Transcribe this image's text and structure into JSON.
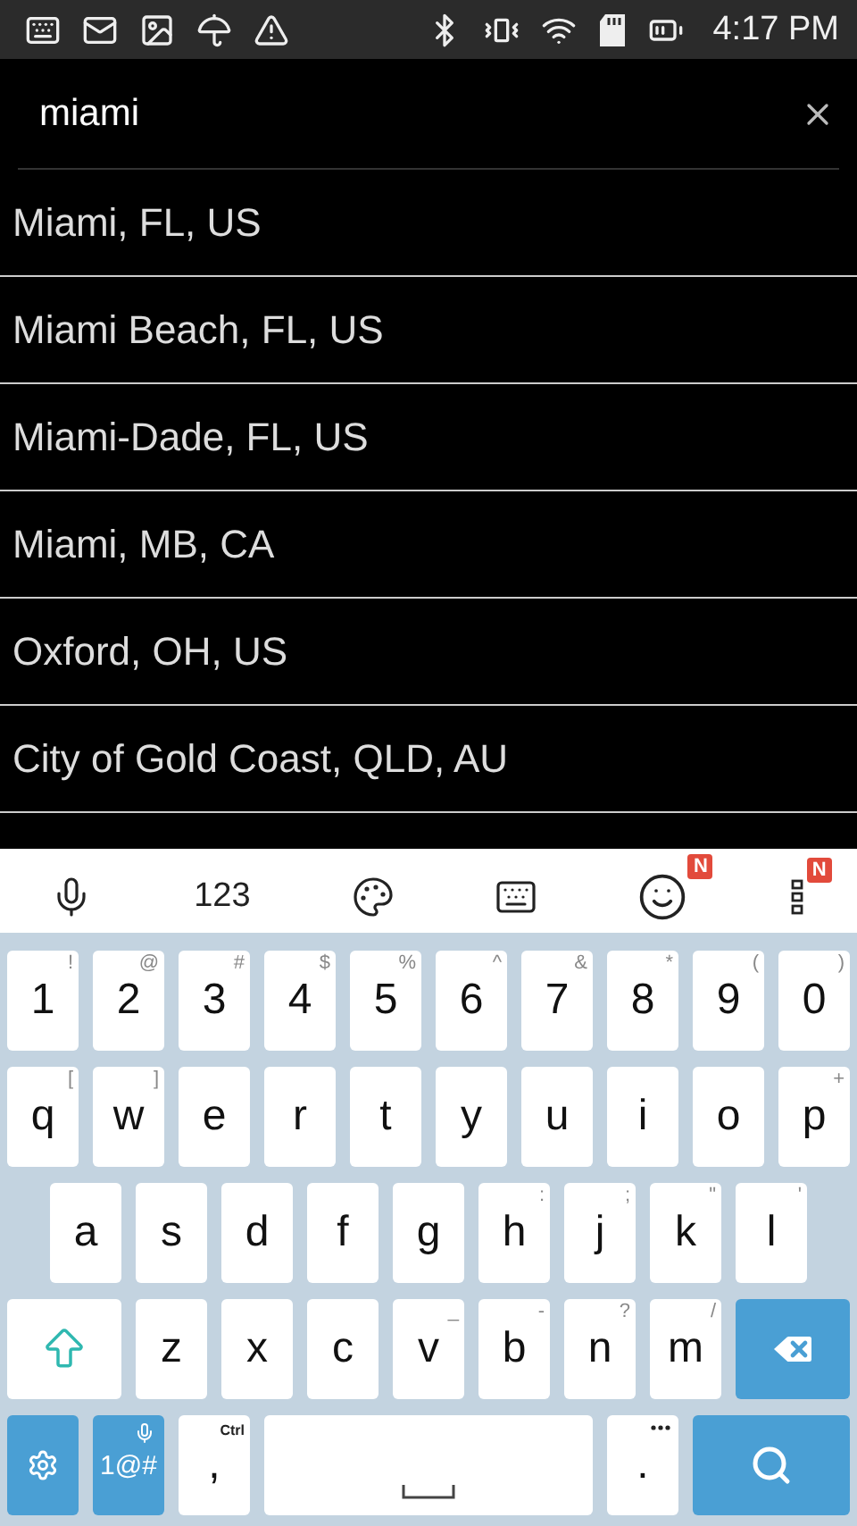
{
  "status_bar": {
    "time": "4:17 PM"
  },
  "search": {
    "value": "miami"
  },
  "results": [
    {
      "label": "Miami, FL, US"
    },
    {
      "label": "Miami Beach, FL, US"
    },
    {
      "label": "Miami-Dade, FL, US"
    },
    {
      "label": "Miami, MB, CA"
    },
    {
      "label": "Oxford, OH, US"
    },
    {
      "label": "City of Gold Coast, QLD, AU"
    }
  ],
  "keyboard_toolbar": [
    {
      "kind": "mic"
    },
    {
      "kind": "text",
      "label": "123"
    },
    {
      "kind": "palette"
    },
    {
      "kind": "hide"
    },
    {
      "kind": "emoji",
      "badge": "N"
    },
    {
      "kind": "menu",
      "badge": "N"
    }
  ],
  "keyboard_rows": [
    [
      {
        "kind": "char",
        "label": "1",
        "hint": "!"
      },
      {
        "kind": "char",
        "label": "2",
        "hint": "@"
      },
      {
        "kind": "char",
        "label": "3",
        "hint": "#"
      },
      {
        "kind": "char",
        "label": "4",
        "hint": "$"
      },
      {
        "kind": "char",
        "label": "5",
        "hint": "%"
      },
      {
        "kind": "char",
        "label": "6",
        "hint": "^"
      },
      {
        "kind": "char",
        "label": "7",
        "hint": "&"
      },
      {
        "kind": "char",
        "label": "8",
        "hint": "*"
      },
      {
        "kind": "char",
        "label": "9",
        "hint": "("
      },
      {
        "kind": "char",
        "label": "0",
        "hint": ")"
      }
    ],
    [
      {
        "kind": "char",
        "label": "q",
        "hint": "["
      },
      {
        "kind": "char",
        "label": "w",
        "hint": "]"
      },
      {
        "kind": "char",
        "label": "e"
      },
      {
        "kind": "char",
        "label": "r"
      },
      {
        "kind": "char",
        "label": "t"
      },
      {
        "kind": "char",
        "label": "y"
      },
      {
        "kind": "char",
        "label": "u"
      },
      {
        "kind": "char",
        "label": "i"
      },
      {
        "kind": "char",
        "label": "o"
      },
      {
        "kind": "char",
        "label": "p",
        "hint": "+"
      }
    ],
    [
      {
        "kind": "char",
        "label": "a"
      },
      {
        "kind": "char",
        "label": "s"
      },
      {
        "kind": "char",
        "label": "d"
      },
      {
        "kind": "char",
        "label": "f"
      },
      {
        "kind": "char",
        "label": "g"
      },
      {
        "kind": "char",
        "label": "h",
        "hint": ":"
      },
      {
        "kind": "char",
        "label": "j",
        "hint": ";"
      },
      {
        "kind": "char",
        "label": "k",
        "hint": "\""
      },
      {
        "kind": "char",
        "label": "l",
        "hint": "'"
      }
    ],
    [
      {
        "kind": "shift"
      },
      {
        "kind": "char",
        "label": "z"
      },
      {
        "kind": "char",
        "label": "x"
      },
      {
        "kind": "char",
        "label": "c"
      },
      {
        "kind": "char",
        "label": "v",
        "hint": "_"
      },
      {
        "kind": "char",
        "label": "b",
        "hint": "-"
      },
      {
        "kind": "char",
        "label": "n",
        "hint": "?"
      },
      {
        "kind": "char",
        "label": "m",
        "hint": "/"
      },
      {
        "kind": "backspace"
      }
    ],
    [
      {
        "kind": "settings"
      },
      {
        "kind": "symbols",
        "label": "1@#"
      },
      {
        "kind": "char",
        "label": ",",
        "hint": "Ctrl"
      },
      {
        "kind": "space"
      },
      {
        "kind": "period",
        "label": "."
      },
      {
        "kind": "search"
      }
    ]
  ]
}
